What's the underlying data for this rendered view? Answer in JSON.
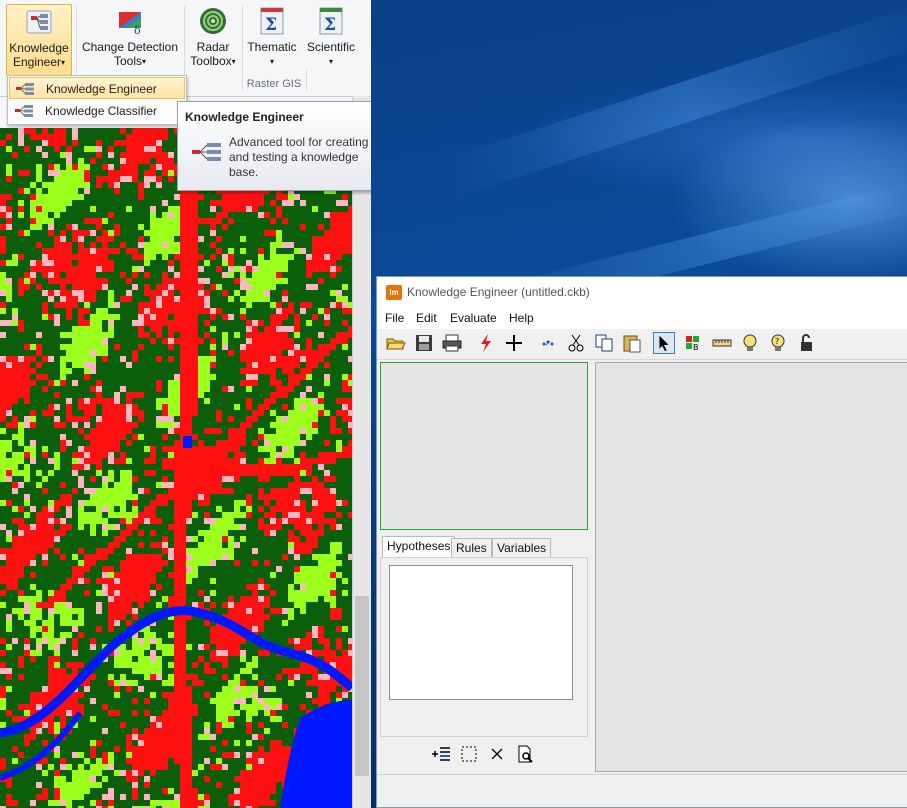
{
  "ribbon": {
    "buttons": [
      {
        "label_line1": "Knowledge",
        "label_line2": "Engineer",
        "icon": "knowledge-engineer-icon"
      },
      {
        "label_line1": "Change Detection",
        "label_line2": "Tools",
        "icon": "change-detection-icon"
      },
      {
        "label_line1": "Radar",
        "label_line2": "Toolbox",
        "icon": "radar-icon"
      },
      {
        "label_line1": "Thematic",
        "label_line2": "",
        "icon": "thematic-sigma-icon"
      },
      {
        "label_line1": "Scientific",
        "label_line2": "",
        "icon": "scientific-sigma-icon"
      }
    ],
    "group_label": "Raster GIS",
    "caret": "▾"
  },
  "dropdown": {
    "items": [
      {
        "label": "Knowledge Engineer"
      },
      {
        "label": "Knowledge Classifier"
      }
    ]
  },
  "tooltip": {
    "title": "Knowledge Engineer",
    "body": "Advanced tool for creating and testing a knowledge base."
  },
  "map": {
    "colors": {
      "forest": "#0c5f0a",
      "urban": "#ff1010",
      "grass": "#9cff1c",
      "bare": "#ffb6c1",
      "water": "#0018ff"
    }
  },
  "ke": {
    "title": "Knowledge Engineer (untitled.ckb)",
    "logo_text": "Im",
    "menu": [
      "File",
      "Edit",
      "Evaluate",
      "Help"
    ],
    "tabs": [
      "Hypotheses",
      "Rules",
      "Variables"
    ]
  }
}
